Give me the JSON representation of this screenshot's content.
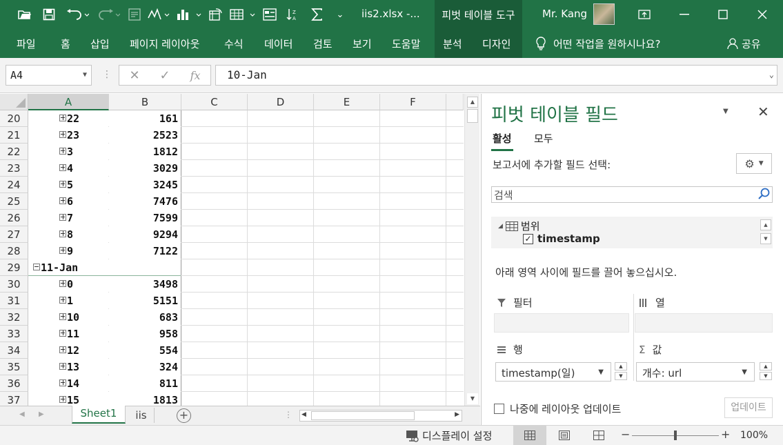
{
  "titlebar": {
    "doc_title": "iis2.xlsx  -...",
    "context_tab": "피벗 테이블 도구",
    "user_name": "Mr. Kang",
    "more": "⌄"
  },
  "ribbon": {
    "tabs": [
      "파일",
      "홈",
      "삽입",
      "페이지 레이아웃",
      "수식",
      "데이터",
      "검토",
      "보기",
      "도움말"
    ],
    "context_tabs": [
      "분석",
      "디자인"
    ],
    "tell_me": "어떤 작업을 원하시나요?",
    "share": "공유"
  },
  "formula_bar": {
    "name_box": "A4",
    "fx": "fx",
    "value": "10-Jan"
  },
  "grid": {
    "columns": [
      "A",
      "B",
      "C",
      "D",
      "E",
      "F"
    ],
    "selected_column": "A",
    "rows": [
      {
        "num": "20",
        "label": "22",
        "value": "161",
        "type": "item"
      },
      {
        "num": "21",
        "label": "23",
        "value": "2523",
        "type": "item"
      },
      {
        "num": "22",
        "label": "3",
        "value": "1812",
        "type": "item"
      },
      {
        "num": "23",
        "label": "4",
        "value": "3029",
        "type": "item"
      },
      {
        "num": "24",
        "label": "5",
        "value": "3245",
        "type": "item"
      },
      {
        "num": "25",
        "label": "6",
        "value": "7476",
        "type": "item"
      },
      {
        "num": "26",
        "label": "7",
        "value": "7599",
        "type": "item"
      },
      {
        "num": "27",
        "label": "8",
        "value": "9294",
        "type": "item"
      },
      {
        "num": "28",
        "label": "9",
        "value": "7122",
        "type": "item"
      },
      {
        "num": "29",
        "label": "11-Jan",
        "value": "",
        "type": "group"
      },
      {
        "num": "30",
        "label": "0",
        "value": "3498",
        "type": "item"
      },
      {
        "num": "31",
        "label": "1",
        "value": "5151",
        "type": "item"
      },
      {
        "num": "32",
        "label": "10",
        "value": "683",
        "type": "item"
      },
      {
        "num": "33",
        "label": "11",
        "value": "958",
        "type": "item"
      },
      {
        "num": "34",
        "label": "12",
        "value": "554",
        "type": "item"
      },
      {
        "num": "35",
        "label": "13",
        "value": "324",
        "type": "item"
      },
      {
        "num": "36",
        "label": "14",
        "value": "811",
        "type": "item"
      },
      {
        "num": "37",
        "label": "15",
        "value": "1813",
        "type": "item"
      }
    ]
  },
  "sheets": {
    "tabs": [
      "Sheet1",
      "iis"
    ],
    "active": "Sheet1"
  },
  "pivot_pane": {
    "title": "피벗 테이블 필드",
    "tab_active": "활성",
    "tab_all": "모두",
    "choose_label": "보고서에 추가할 필드 선택:",
    "search_placeholder": "검색",
    "range_label": "범위",
    "field_name": "timestamp",
    "field_checked": true,
    "drag_hint": "아래 영역 사이에 필드를 끌어 놓으십시오.",
    "areas": {
      "filter": "필터",
      "columns": "열",
      "rows": "행",
      "values": "값"
    },
    "row_field": "timestamp(일)",
    "value_field": "개수: url",
    "defer_label": "나중에 레이아웃 업데이트",
    "update_button": "업데이트"
  },
  "statusbar": {
    "display_settings": "디스플레이 설정",
    "zoom_level": "100%",
    "zoom_minus": "−",
    "zoom_plus": "+",
    "zoom_fraction": 0.5
  }
}
